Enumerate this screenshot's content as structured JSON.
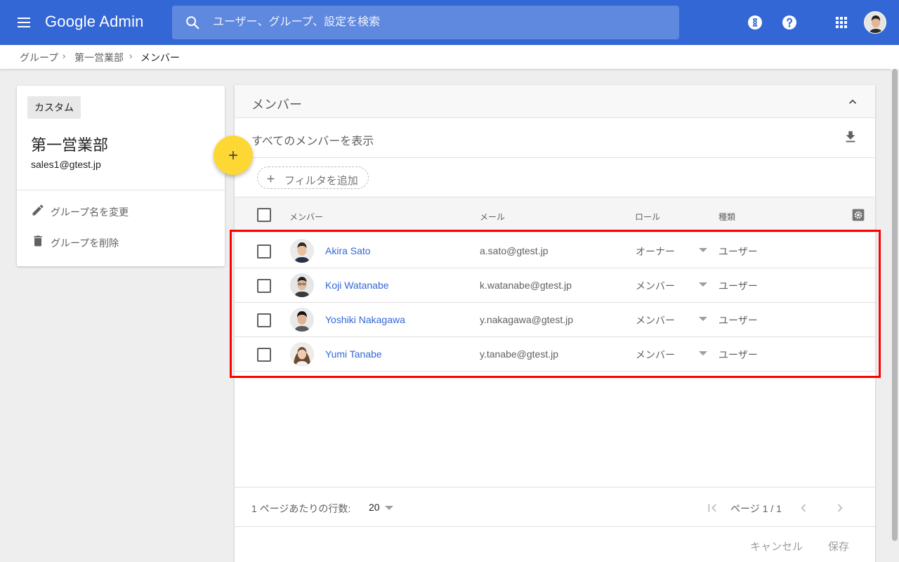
{
  "app": {
    "brand": "Google Admin"
  },
  "search": {
    "placeholder": "ユーザー、グループ、設定を検索"
  },
  "breadcrumb": {
    "items": [
      "グループ",
      "第一営業部",
      "メンバー"
    ],
    "separator": "›"
  },
  "group": {
    "chip": "カスタム",
    "name": "第一営業部",
    "email": "sales1@gtest.jp",
    "actions": [
      "グループ名を変更",
      "グループを削除"
    ]
  },
  "members": {
    "title": "メンバー",
    "view_all": "すべてのメンバーを表示",
    "add_filter": "フィルタを追加",
    "columns": [
      "メンバー",
      "メール",
      "ロール",
      "種類"
    ],
    "rows": [
      {
        "name": "Akira Sato",
        "email": "a.sato@gtest.jp",
        "role": "オーナー",
        "type": "ユーザー"
      },
      {
        "name": "Koji Watanabe",
        "email": "k.watanabe@gtest.jp",
        "role": "メンバー",
        "type": "ユーザー"
      },
      {
        "name": "Yoshiki Nakagawa",
        "email": "y.nakagawa@gtest.jp",
        "role": "メンバー",
        "type": "ユーザー"
      },
      {
        "name": "Yumi Tanabe",
        "email": "y.tanabe@gtest.jp",
        "role": "メンバー",
        "type": "ユーザー"
      }
    ],
    "rows_per_page_label": "1 ページあたりの行数:",
    "rows_per_page": "20",
    "page_label": "ページ 1 / 1",
    "cancel": "キャンセル",
    "save": "保存"
  },
  "colors": {
    "topbar": "#3367d6",
    "fab": "#fdd835",
    "link": "#3367d6",
    "highlight": "#ff0000"
  },
  "icons": [
    "hamburger-icon",
    "search-icon",
    "hourglass-icon",
    "help-icon",
    "apps-grid-icon",
    "pencil-icon",
    "trash-icon",
    "plus-icon",
    "chevron-up-icon",
    "download-icon",
    "gear-icon",
    "dropdown-arrow-icon",
    "first-page-icon",
    "chevron-left-icon",
    "chevron-right-icon"
  ]
}
